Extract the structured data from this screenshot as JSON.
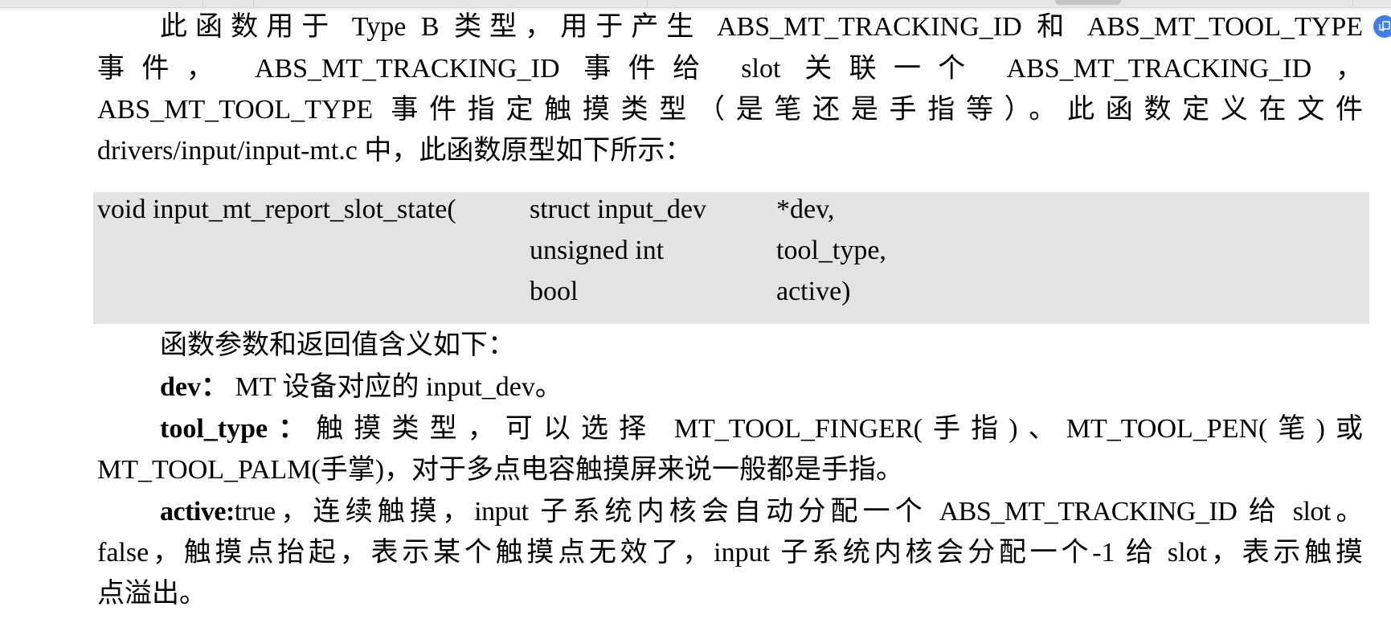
{
  "window": {
    "scrollbar_label": "horizontal-scroll"
  },
  "document": {
    "para1": {
      "line1": "此函数用于 Type B 类型，用于产生 ABS_MT_TRACKING_ID 和 ABS_MT_TOOL_TYPE",
      "line2": "事件， ABS_MT_TRACKING_ID 事件给 slot 关联一个 ABS_MT_TRACKING_ID ，",
      "line3": "ABS_MT_TOOL_TYPE 事件指定触摸类型（是笔还是手指等）。此函数定义在文件",
      "line4": "drivers/input/input-mt.c 中，此函数原型如下所示："
    },
    "code": {
      "rows": [
        {
          "c1": "void input_mt_report_slot_state(",
          "c2": "struct input_dev",
          "c3": "*dev,"
        },
        {
          "c1": "",
          "c2": "unsigned int",
          "c3": "tool_type,"
        },
        {
          "c1": "",
          "c2": "bool",
          "c3": "active)"
        }
      ]
    },
    "params_intro": "函数参数和返回值含义如下：",
    "params": {
      "dev": {
        "name": "dev：",
        "desc": " MT 设备对应的 input_dev。"
      },
      "tool_type": {
        "name": "tool_type：",
        "desc_line1": "触摸类型，可以选择 MT_TOOL_FINGER(手指)、MT_TOOL_PEN(笔)或",
        "desc_line2": "MT_TOOL_PALM(手掌)，对于多点电容触摸屏来说一般都是手指。"
      },
      "active": {
        "name": "active:",
        "desc_line1": "true，连续触摸，input 子系统内核会自动分配一个 ABS_MT_TRACKING_ID 给 slot。",
        "desc_line2": "false，触摸点抬起，表示某个触摸点无效了，input 子系统内核会分配一个-1 给 slot，表示触摸",
        "desc_line3": "点溢出。"
      }
    }
  },
  "floating_badge": {
    "icon": "translate-screenshot-icon",
    "color": "#3d7ff0"
  }
}
